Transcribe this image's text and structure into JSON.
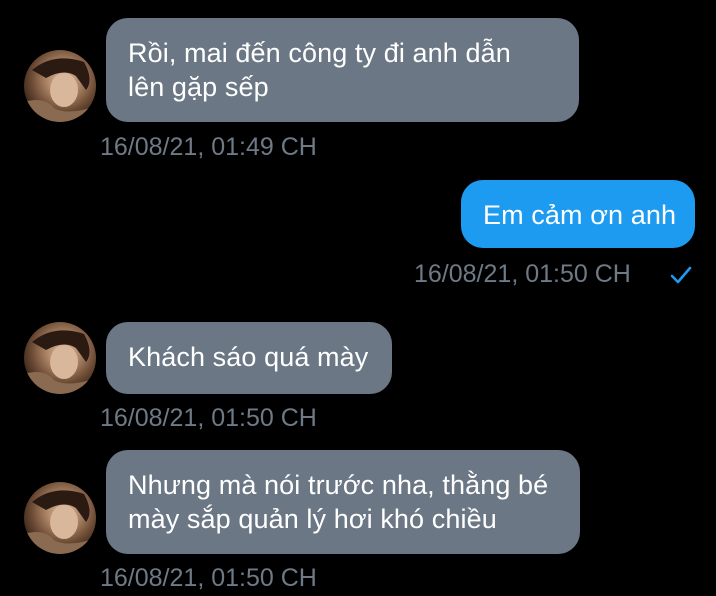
{
  "messages": [
    {
      "direction": "incoming",
      "lines": [
        "Rồi, mai đến công ty đi anh dẫn",
        "lên gặp sếp"
      ],
      "timestamp": "16/08/21, 01:49 CH"
    },
    {
      "direction": "outgoing",
      "lines": [
        "Em cảm ơn anh"
      ],
      "timestamp": "16/08/21, 01:50 CH",
      "status_icon": "checkmark-icon"
    },
    {
      "direction": "incoming",
      "lines": [
        "Khách sáo quá mày"
      ],
      "timestamp": "16/08/21, 01:50 CH"
    },
    {
      "direction": "incoming",
      "lines": [
        "Nhưng mà nói trước nha, thằng bé",
        "mày sắp quản lý hơi khó chiều"
      ],
      "timestamp": "16/08/21, 01:50 CH"
    }
  ],
  "colors": {
    "background": "#000000",
    "incoming_bubble": "#6b7784",
    "outgoing_bubble": "#1d9bf0",
    "timestamp": "#6e7a86",
    "check": "#1d9bf0"
  }
}
